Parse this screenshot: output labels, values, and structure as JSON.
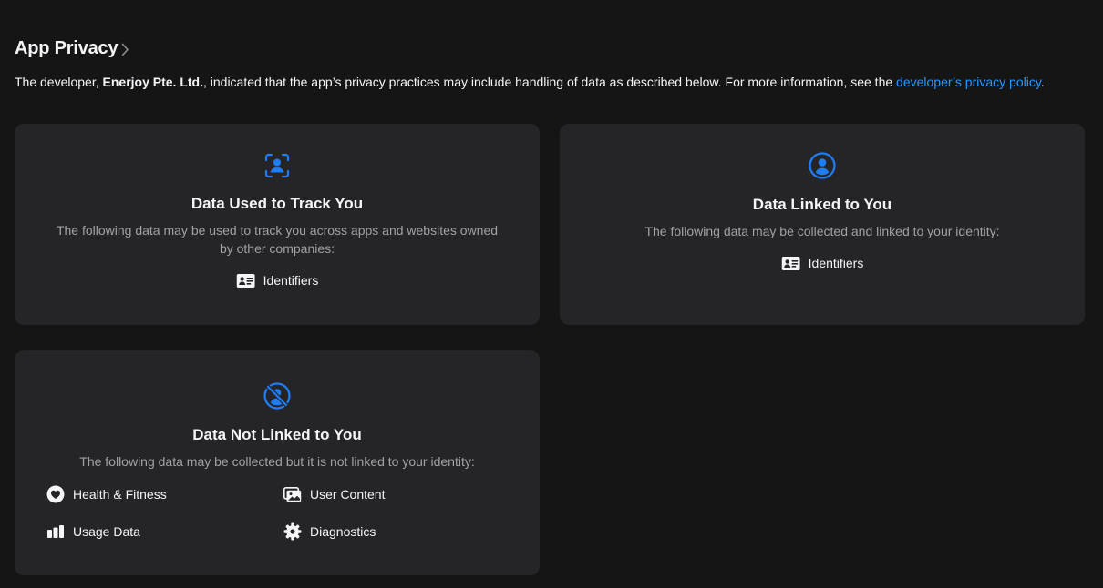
{
  "section": {
    "title": "App Privacy"
  },
  "intro": {
    "prefix": "The developer, ",
    "developer": "Enerjoy Pte. Ltd.",
    "middle": ", indicated that the app’s privacy practices may include handling of data as described below. For more information, see the ",
    "link": "developer’s privacy policy",
    "suffix": "."
  },
  "cards": {
    "track": {
      "title": "Data Used to Track You",
      "description": "The following data may be used to track you across apps and websites owned by other companies:",
      "items": [
        "Identifiers"
      ]
    },
    "linked": {
      "title": "Data Linked to You",
      "description": "The following data may be collected and linked to your identity:",
      "items": [
        "Identifiers"
      ]
    },
    "not_linked": {
      "title": "Data Not Linked to You",
      "description": "The following data may be collected but it is not linked to your identity:",
      "items": [
        "Health & Fitness",
        "User Content",
        "Usage Data",
        "Diagnostics"
      ]
    }
  },
  "colors": {
    "accent": "#2997ff",
    "icon_blue": "#1f7cf2",
    "background": "#151516",
    "card": "#252527"
  },
  "icons": {
    "track": "person-viewfinder-icon",
    "linked": "person-circle-icon",
    "not_linked": "person-slash-icon",
    "identifiers": "id-card-icon",
    "health": "heart-icon",
    "user_content": "photos-icon",
    "usage": "bar-chart-icon",
    "diagnostics": "gear-icon"
  }
}
